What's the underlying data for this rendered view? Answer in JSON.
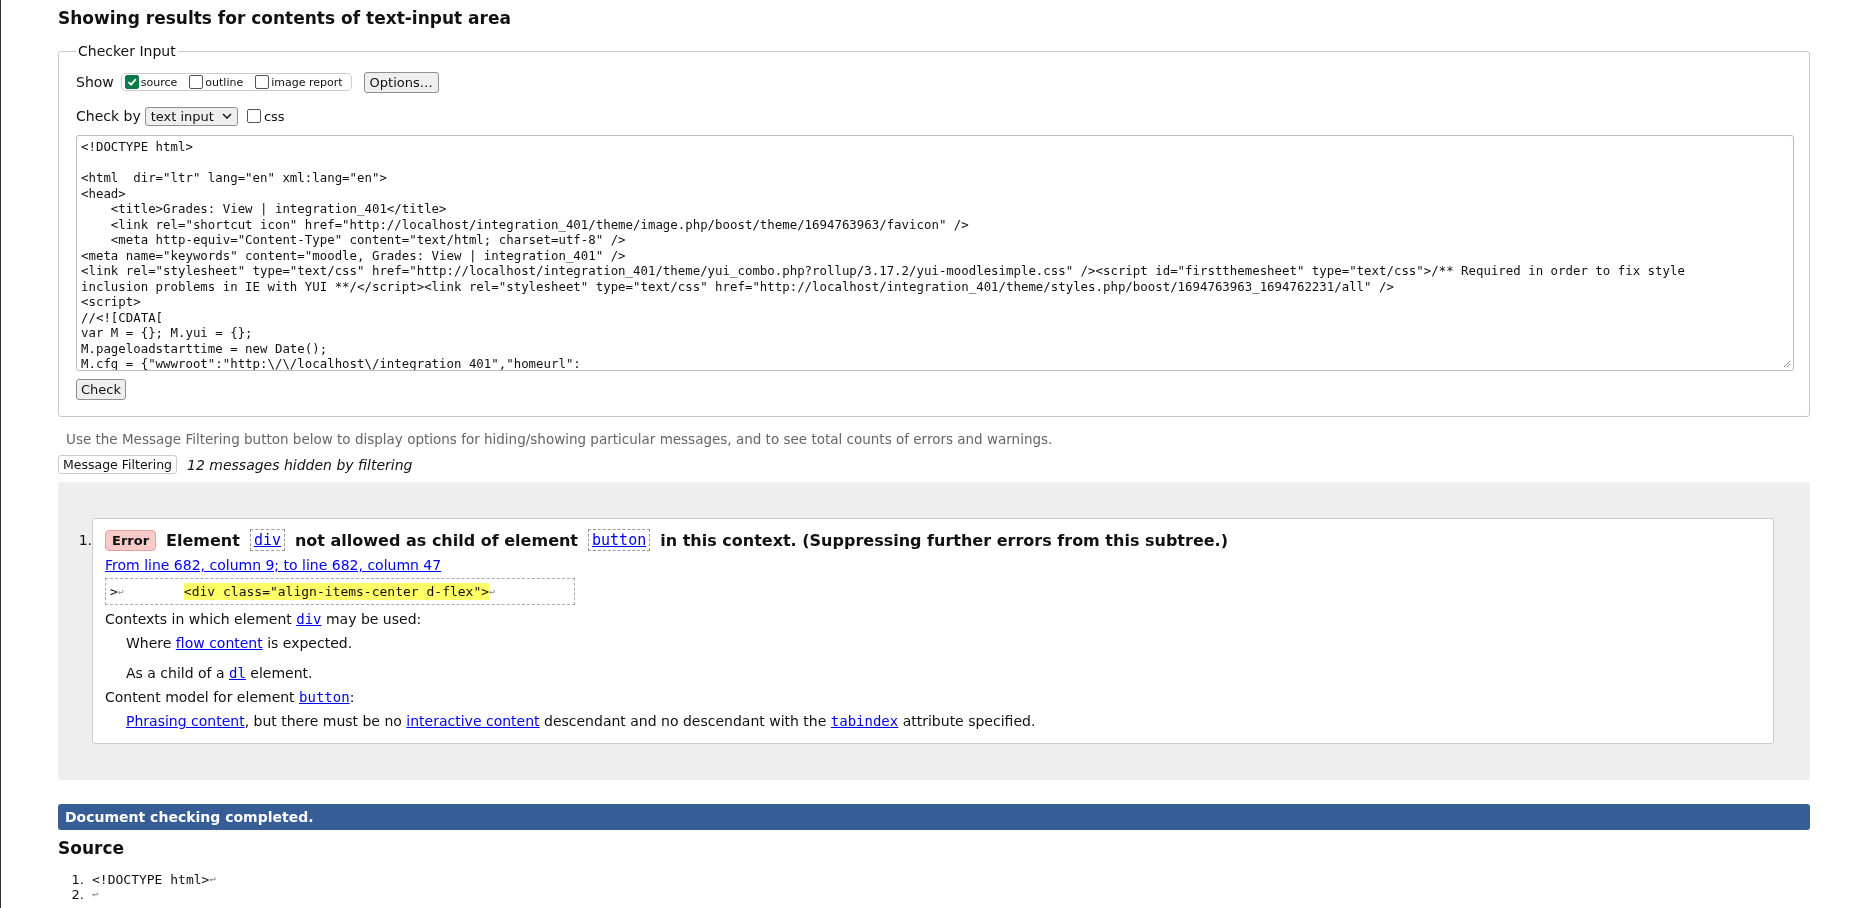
{
  "heading": "Showing results for contents of text-input area",
  "checker_input": {
    "legend": "Checker Input",
    "show_label": "Show",
    "show_options": [
      {
        "label": "source",
        "checked": true
      },
      {
        "label": "outline",
        "checked": false
      },
      {
        "label": "image report",
        "checked": false
      }
    ],
    "options_button": "Options…",
    "check_by_label": "Check by",
    "check_by_select": "text input",
    "css_option": {
      "label": "css",
      "checked": false
    },
    "source_text": "<!DOCTYPE html>\n\n<html  dir=\"ltr\" lang=\"en\" xml:lang=\"en\">\n<head>\n    <title>Grades: View | integration_401</title>\n    <link rel=\"shortcut icon\" href=\"http://localhost/integration_401/theme/image.php/boost/theme/1694763963/favicon\" />\n    <meta http-equiv=\"Content-Type\" content=\"text/html; charset=utf-8\" />\n<meta name=\"keywords\" content=\"moodle, Grades: View | integration_401\" />\n<link rel=\"stylesheet\" type=\"text/css\" href=\"http://localhost/integration_401/theme/yui_combo.php?rollup/3.17.2/yui-moodlesimple.css\" /><script id=\"firstthemesheet\" type=\"text/css\">/** Required in order to fix style\ninclusion problems in IE with YUI **/</script><link rel=\"stylesheet\" type=\"text/css\" href=\"http://localhost/integration_401/theme/styles.php/boost/1694763963_1694762231/all\" />\n<script>\n//<![CDATA[\nvar M = {}; M.yui = {};\nM.pageloadstarttime = new Date();\nM.cfg = {\"wwwroot\":\"http:\\/\\/localhost\\/integration_401\",\"homeurl\":",
    "check_button": "Check"
  },
  "filter_hint": "Use the Message Filtering button below to display options for hiding/showing particular messages, and to see total counts of errors and warnings.",
  "filter_button": "Message Filtering",
  "hidden_count": "12 messages hidden by filtering",
  "messages": [
    {
      "number": "1.",
      "kind": "error",
      "type_label": "Error",
      "title": [
        {
          "kind": "text",
          "text": "Element"
        },
        {
          "kind": "code",
          "text": "div"
        },
        {
          "kind": "text",
          "text": "not allowed as child of element"
        },
        {
          "kind": "code",
          "text": "button"
        },
        {
          "kind": "text",
          "text": "in this context. (Suppressing further errors from this subtree.)"
        }
      ],
      "location": "From line 682, column 9; to line 682, column 47",
      "extract": [
        {
          "kind": "text",
          "text": ">"
        },
        {
          "kind": "lf",
          "text": "↩"
        },
        {
          "kind": "highlight",
          "text": "<div class=\"align-items-center d-flex\">"
        },
        {
          "kind": "lf",
          "text": "↩"
        }
      ],
      "details": [
        {
          "kind": "heading",
          "parts": [
            {
              "kind": "text",
              "text": "Contexts in which element "
            },
            {
              "kind": "code",
              "text": "div"
            },
            {
              "kind": "text",
              "text": " may be used:"
            }
          ]
        },
        {
          "kind": "item",
          "parts": [
            {
              "kind": "text",
              "text": "Where "
            },
            {
              "kind": "link",
              "text": "flow content"
            },
            {
              "kind": "text",
              "text": " is expected."
            }
          ]
        },
        {
          "kind": "item",
          "parts": [
            {
              "kind": "text",
              "text": "As a child of a "
            },
            {
              "kind": "code",
              "text": "dl"
            },
            {
              "kind": "text",
              "text": " element."
            }
          ]
        },
        {
          "kind": "heading",
          "parts": [
            {
              "kind": "text",
              "text": "Content model for element "
            },
            {
              "kind": "code",
              "text": "button"
            },
            {
              "kind": "text",
              "text": ":"
            }
          ]
        },
        {
          "kind": "item",
          "parts": [
            {
              "kind": "link",
              "text": "Phrasing content"
            },
            {
              "kind": "text",
              "text": ", but there must be no "
            },
            {
              "kind": "link",
              "text": "interactive content"
            },
            {
              "kind": "text",
              "text": " descendant and no descendant with the "
            },
            {
              "kind": "code",
              "text": "tabindex"
            },
            {
              "kind": "text",
              "text": " attribute specified."
            }
          ]
        }
      ]
    }
  ],
  "status": "Document checking completed.",
  "source_heading": "Source",
  "source_listing": [
    {
      "number": "1.",
      "text": "<!DOCTYPE html>",
      "lf": "↩"
    },
    {
      "number": "2.",
      "lf": "↩"
    }
  ]
}
